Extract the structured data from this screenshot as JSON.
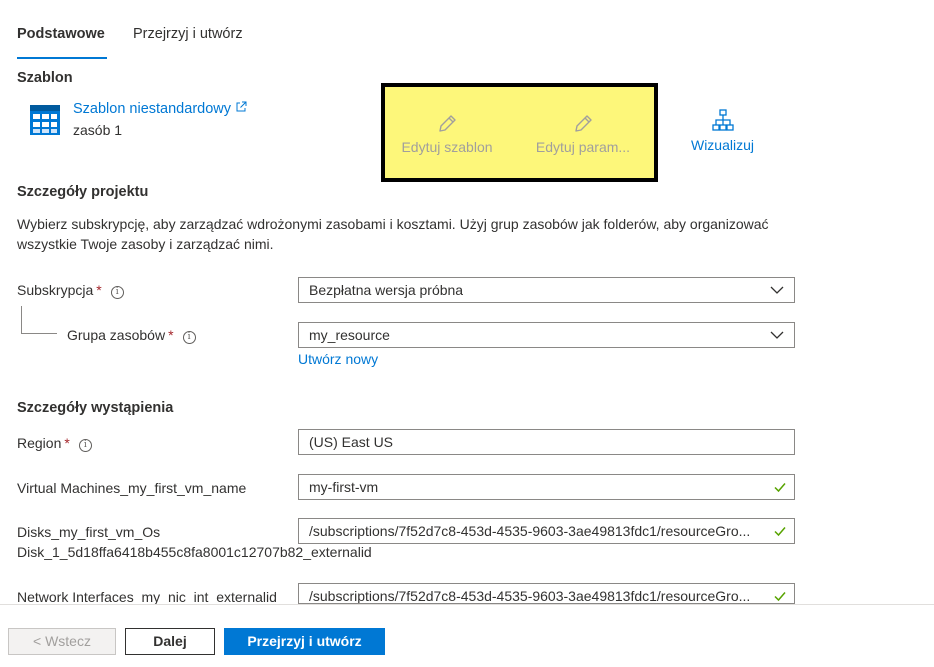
{
  "tabs": [
    {
      "label": "Podstawowe"
    },
    {
      "label": "Przejrzyj i utwórz"
    }
  ],
  "template": {
    "heading": "Szablon",
    "name": "Szablon niestandardowy",
    "external_icon": "external-link-icon",
    "resource_count": "zasób 1",
    "icon": "template-grid-icon"
  },
  "toolbar": {
    "edit_template": "Edytuj szablon",
    "edit_params": "Edytuj param...",
    "visualize": "Wizualizuj"
  },
  "project": {
    "heading": "Szczegóły projektu",
    "description": "Wybierz subskrypcję, aby zarządzać wdrożonymi zasobami i kosztami. Użyj grup zasobów jak folderów, aby organizować wszystkie Twoje zasoby i zarządzać nimi.",
    "subscription": {
      "label": "Subskrypcja",
      "required": "*",
      "value": "Bezpłatna wersja próbna"
    },
    "resource_group": {
      "label": "Grupa zasobów",
      "required": "*",
      "value": "my_resource",
      "create_new": "Utwórz nowy"
    }
  },
  "instance": {
    "heading": "Szczegóły wystąpienia",
    "region": {
      "label": "Region",
      "required": "*",
      "value": "(US) East US"
    },
    "vm_name": {
      "label": "Virtual Machines_my_first_vm_name",
      "value": "my-first-vm"
    },
    "disk": {
      "label_line1": "Disks_my_first_vm_Os",
      "label_line2": "Disk_1_5d18ffa6418b455c8fa8001c12707b82_externalid",
      "value": "/subscriptions/7f52d7c8-453d-4535-9603-3ae49813fdc1/resourceGro..."
    },
    "nic": {
      "label": "Network Interfaces_my_nic_int_externalid",
      "value": "/subscriptions/7f52d7c8-453d-4535-9603-3ae49813fdc1/resourceGro..."
    }
  },
  "footer": {
    "back": "< Wstecz",
    "next": "Dalej",
    "review_create": "Przejrzyj i utwórz"
  },
  "colors": {
    "accent": "#0078d4",
    "highlight": "#fdf77a",
    "valid": "#57a300",
    "required": "#a4262c"
  }
}
